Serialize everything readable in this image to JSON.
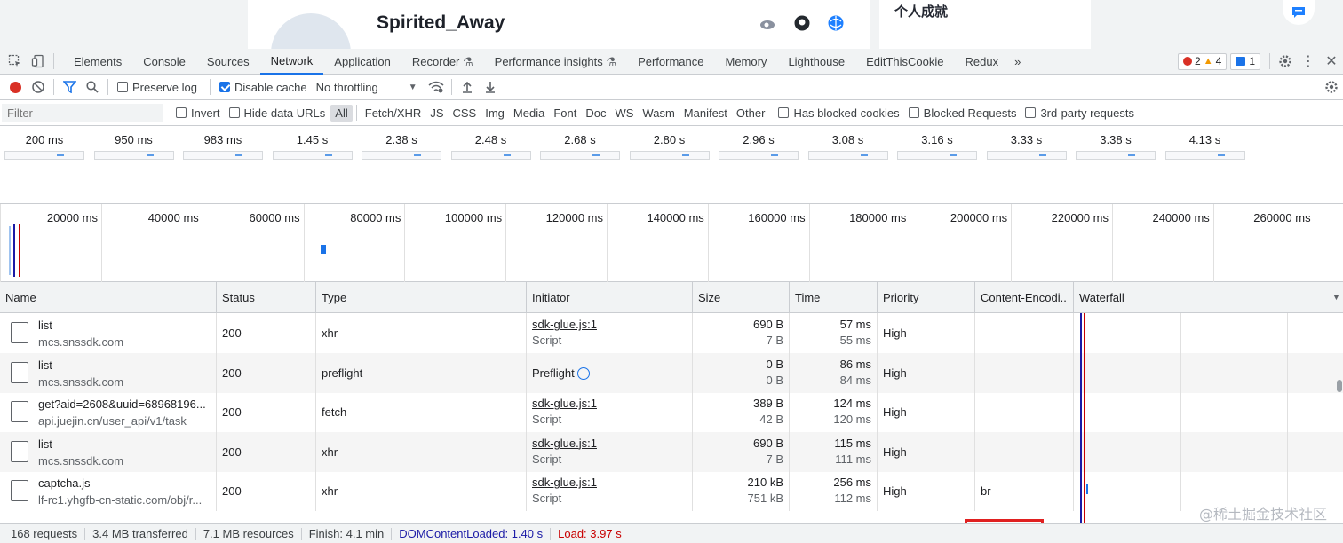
{
  "page": {
    "username": "Spirited_Away",
    "side_title": "个人成就"
  },
  "tabs": [
    "Elements",
    "Console",
    "Sources",
    "Network",
    "Application",
    "Recorder",
    "Performance insights",
    "Performance",
    "Memory",
    "Lighthouse",
    "EditThisCookie",
    "Redux"
  ],
  "tabs_active": "Network",
  "issues": {
    "errors": "2",
    "warnings": "4",
    "messages": "1"
  },
  "toolbar": {
    "preserve_log": "Preserve log",
    "disable_cache": "Disable cache",
    "throttling": "No throttling"
  },
  "filter": {
    "placeholder": "Filter",
    "invert": "Invert",
    "hide_data_urls": "Hide data URLs",
    "types": [
      "All",
      "Fetch/XHR",
      "JS",
      "CSS",
      "Img",
      "Media",
      "Font",
      "Doc",
      "WS",
      "Wasm",
      "Manifest",
      "Other"
    ],
    "blocked_cookies": "Has blocked cookies",
    "blocked_requests": "Blocked Requests",
    "third_party": "3rd-party requests"
  },
  "screenshots": [
    "200 ms",
    "950 ms",
    "983 ms",
    "1.45 s",
    "2.38 s",
    "2.48 s",
    "2.68 s",
    "2.80 s",
    "2.96 s",
    "3.08 s",
    "3.16 s",
    "3.33 s",
    "3.38 s",
    "4.13 s"
  ],
  "overview_ticks": [
    "20000 ms",
    "40000 ms",
    "60000 ms",
    "80000 ms",
    "100000 ms",
    "120000 ms",
    "140000 ms",
    "160000 ms",
    "180000 ms",
    "200000 ms",
    "220000 ms",
    "240000 ms",
    "260000 ms"
  ],
  "columns": [
    "Name",
    "Status",
    "Type",
    "Initiator",
    "Size",
    "Time",
    "Priority",
    "Content-Encodi..",
    "Waterfall"
  ],
  "rows": [
    {
      "name": "list",
      "domain": "mcs.snssdk.com",
      "status": "200",
      "type": "xhr",
      "initiator": "sdk-glue.js:1",
      "initiator_type": "Script",
      "size": "690 B",
      "resource": "7 B",
      "time": "57 ms",
      "latency": "55 ms",
      "priority": "High",
      "encoding": ""
    },
    {
      "name": "list",
      "domain": "mcs.snssdk.com",
      "status": "200",
      "type": "preflight",
      "initiator": "Preflight",
      "initiator_type": "",
      "size": "0 B",
      "resource": "0 B",
      "time": "86 ms",
      "latency": "84 ms",
      "priority": "High",
      "encoding": ""
    },
    {
      "name": "get?aid=2608&uuid=68968196...",
      "domain": "api.juejin.cn/user_api/v1/task",
      "status": "200",
      "type": "fetch",
      "initiator": "sdk-glue.js:1",
      "initiator_type": "Script",
      "size": "389 B",
      "resource": "42 B",
      "time": "124 ms",
      "latency": "120 ms",
      "priority": "High",
      "encoding": ""
    },
    {
      "name": "list",
      "domain": "mcs.snssdk.com",
      "status": "200",
      "type": "xhr",
      "initiator": "sdk-glue.js:1",
      "initiator_type": "Script",
      "size": "690 B",
      "resource": "7 B",
      "time": "115 ms",
      "latency": "111 ms",
      "priority": "High",
      "encoding": ""
    },
    {
      "name": "captcha.js",
      "domain": "lf-rc1.yhgfb-cn-static.com/obj/r...",
      "status": "200",
      "type": "xhr",
      "initiator": "sdk-glue.js:1",
      "initiator_type": "Script",
      "size": "210 kB",
      "resource": "751 kB",
      "time": "256 ms",
      "latency": "112 ms",
      "priority": "High",
      "encoding": "br"
    }
  ],
  "status": {
    "requests": "168 requests",
    "transferred": "3.4 MB transferred",
    "resources": "7.1 MB resources",
    "finish": "Finish: 4.1 min",
    "dcl": "DOMContentLoaded: 1.40 s",
    "load": "Load: 3.97 s"
  },
  "watermark": "@稀土掘金技术社区",
  "colors": {
    "accent": "#1a73e8",
    "dcl": "#1a1aa6",
    "load": "#c80000",
    "highlight": "#e02020"
  }
}
